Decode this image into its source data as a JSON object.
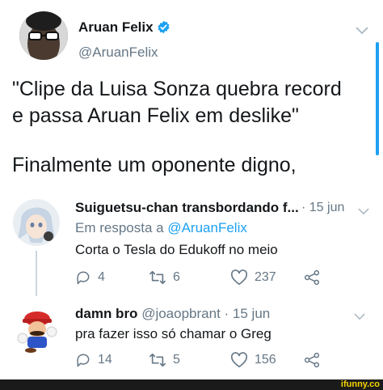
{
  "tweet": {
    "name": "Aruan Felix",
    "handle": "@AruanFelix",
    "text_line1": "\"Clipe da Luisa Sonza quebra record",
    "text_line2": "e passa Aruan Felix em deslike\"",
    "text_line3": "Finalmente um oponente digno,"
  },
  "replies": [
    {
      "name": "Suiguetsu-chan transbordando f...",
      "time": "· 15 jun",
      "reply_to_prefix": "Em resposta a ",
      "reply_to_handle": "@AruanFelix",
      "text": "Corta o Tesla do Edukoff no meio",
      "replies_count": "4",
      "retweets_count": "6",
      "likes_count": "237"
    },
    {
      "name": "damn bro",
      "handle": "@joaopbrant",
      "time": "· 15 jun",
      "text": "pra fazer isso só chamar o Greg",
      "replies_count": "14",
      "retweets_count": "5",
      "likes_count": "156"
    }
  ],
  "watermark": "ifunny.co",
  "colors": {
    "accent": "#1da1f2",
    "muted": "#657786",
    "text": "#14171a",
    "watermark": "#f5d400"
  }
}
